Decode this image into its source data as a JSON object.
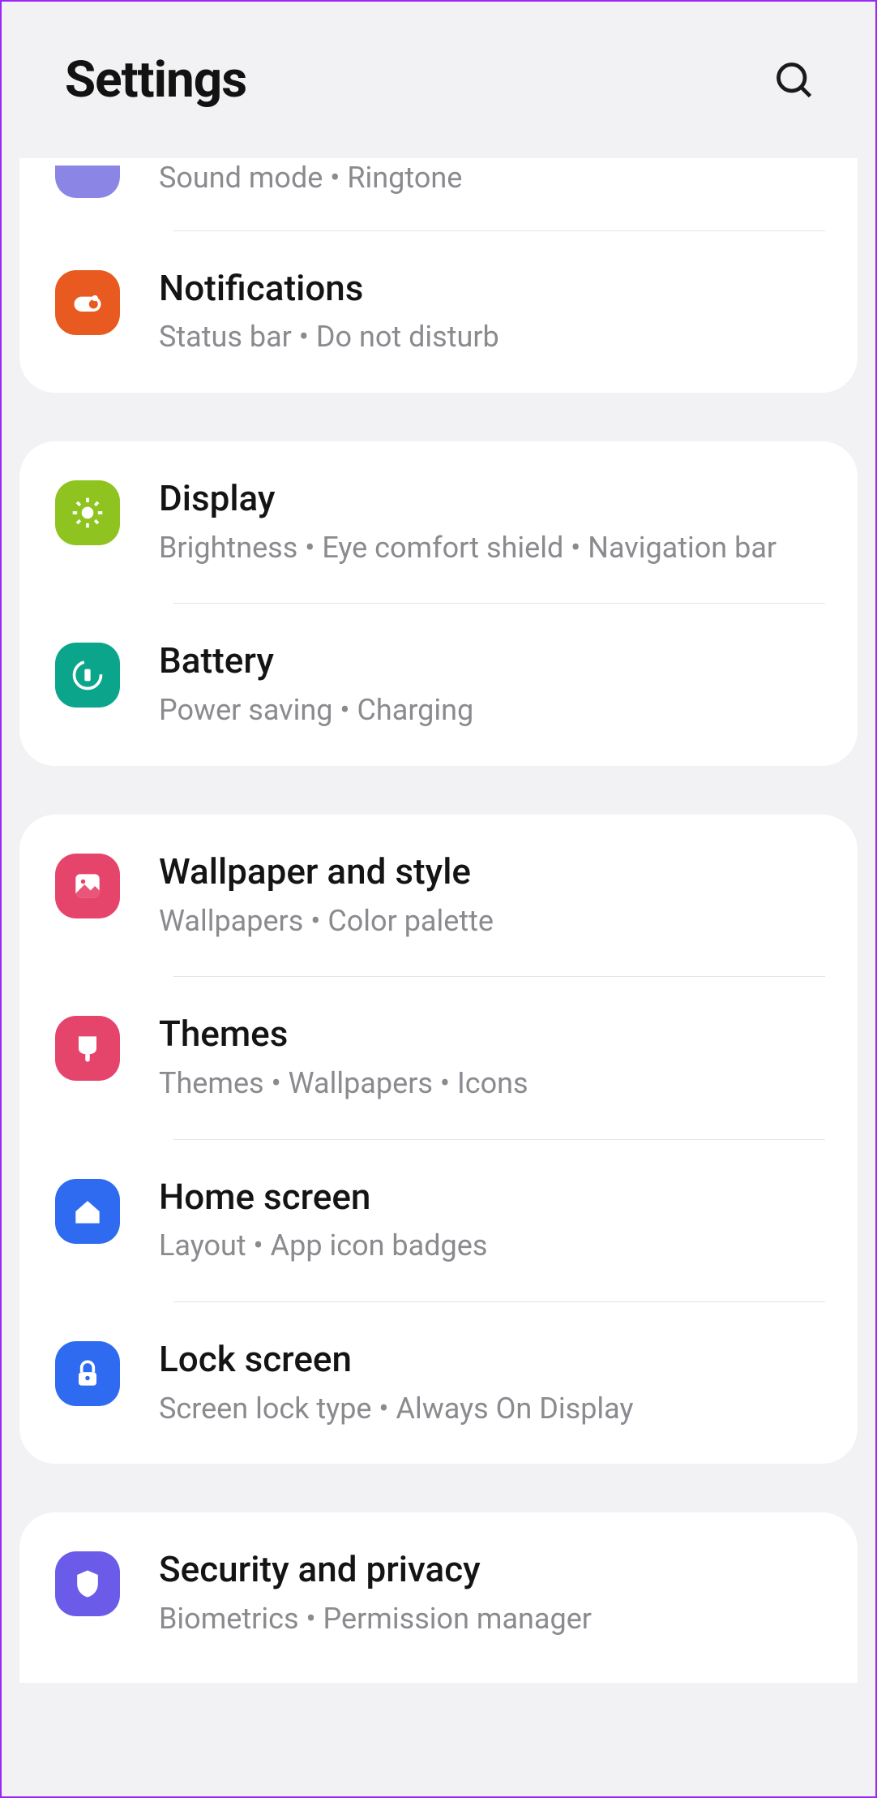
{
  "header": {
    "title": "Settings"
  },
  "groups": [
    {
      "items": [
        {
          "key": "sounds",
          "title": "",
          "subtitle": "Sound mode  •  Ringtone",
          "color": "#8b86e6",
          "icon": "speaker",
          "partial": true
        },
        {
          "key": "notifications",
          "title": "Notifications",
          "subtitle": "Status bar  •  Do not disturb",
          "color": "#e85a1f",
          "icon": "toggle"
        }
      ]
    },
    {
      "items": [
        {
          "key": "display",
          "title": "Display",
          "subtitle": "Brightness  •  Eye comfort shield  •  Navigation bar",
          "color": "#8fc31f",
          "icon": "sun"
        },
        {
          "key": "battery",
          "title": "Battery",
          "subtitle": "Power saving  •  Charging",
          "color": "#0aa58a",
          "icon": "battery"
        }
      ]
    },
    {
      "items": [
        {
          "key": "wallpaper",
          "title": "Wallpaper and style",
          "subtitle": "Wallpapers  •  Color palette",
          "color": "#e6456b",
          "icon": "image"
        },
        {
          "key": "themes",
          "title": "Themes",
          "subtitle": "Themes  •  Wallpapers  •  Icons",
          "color": "#e6456b",
          "icon": "brush"
        },
        {
          "key": "home",
          "title": "Home screen",
          "subtitle": "Layout  •  App icon badges",
          "color": "#2f6bf0",
          "icon": "home"
        },
        {
          "key": "lock",
          "title": "Lock screen",
          "subtitle": "Screen lock type  •  Always On Display",
          "color": "#2f6bf0",
          "icon": "lock"
        }
      ]
    },
    {
      "items": [
        {
          "key": "security",
          "title": "Security and privacy",
          "subtitle": "Biometrics  •  Permission manager",
          "color": "#6a5ce8",
          "icon": "shield"
        }
      ]
    }
  ]
}
